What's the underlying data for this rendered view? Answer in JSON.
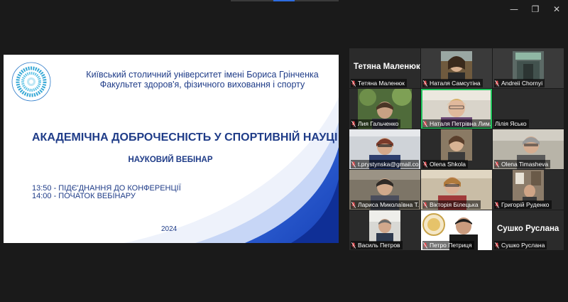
{
  "window_controls": {
    "minimize": "—",
    "maximize": "❐",
    "close": "✕"
  },
  "slide": {
    "university": "Київський столичний університет імені Бориса Грінченка",
    "faculty": "Факультет здоров'я, фізичного виховання і спорту",
    "title": "АКАДЕМІЧНА ДОБРОЧЕСНІСТЬ У СПОРТИВНІЙ НАУЦІ",
    "subtitle": "НАУКОВИЙ ВЕБІНАР",
    "schedule": [
      "13:50 - ПІДЄ'ДНАННЯ ДО КОНФЕРЕНЦІЇ",
      "14:00 - ПОЧАТОК ВЕБІНАРУ"
    ],
    "year": "2024",
    "logo_text": "КИЇВСЬКИЙ СТОЛИЧНИЙ УНІВЕРСИТЕТ ІМЕНІ БОРИСА ГРІНЧЕНКА"
  },
  "participants": [
    {
      "name": "Тетяна Маленюк",
      "big_name": "Тетяна Маленюк",
      "video": false,
      "muted": true
    },
    {
      "name": "Наталя Самсутіна",
      "video": true,
      "muted": true
    },
    {
      "name": "Andreii Chornyi",
      "video": true,
      "muted": true
    },
    {
      "name": "Лия Гальченко",
      "video": true,
      "muted": true
    },
    {
      "name": "Наталя Петрівна Лим...",
      "video": true,
      "muted": true,
      "speaking": true
    },
    {
      "name": "Лілія Яськo",
      "video": false,
      "muted": false
    },
    {
      "name": "t.prystynska@gmail.com",
      "video": true,
      "muted": true
    },
    {
      "name": "Olena Shkola",
      "video": true,
      "muted": true
    },
    {
      "name": "Olena Timasheva",
      "video": true,
      "muted": true
    },
    {
      "name": "Лариса Миколаївна Т...",
      "video": true,
      "muted": true
    },
    {
      "name": "Вікторія Білецька",
      "video": true,
      "muted": true
    },
    {
      "name": "Григорій Руденко",
      "video": true,
      "muted": true
    },
    {
      "name": "Василь Петров",
      "video": true,
      "muted": true
    },
    {
      "name": "Петро Петриця",
      "video": true,
      "muted": true
    },
    {
      "name": "Сушко Руслана",
      "big_name": "Сушко Руслана",
      "video": false,
      "muted": true
    }
  ],
  "colors": {
    "accent_blue": "#1f3c88",
    "active_speaker": "#22c55e",
    "muted_icon": "#e5484d"
  },
  "icons": {
    "muted": "mic-off-icon"
  }
}
